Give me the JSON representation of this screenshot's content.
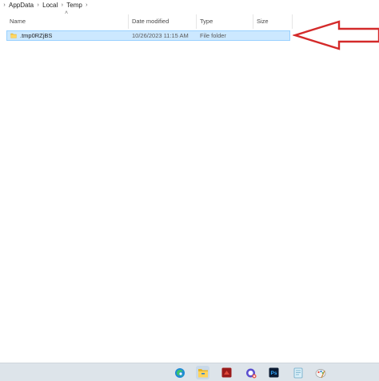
{
  "breadcrumb": {
    "items": [
      "AppData",
      "Local",
      "Temp"
    ]
  },
  "columns": {
    "name": "Name",
    "date_modified": "Date modified",
    "type": "Type",
    "size": "Size"
  },
  "rows": [
    {
      "name": ".tmp0RZjBS",
      "date_modified": "10/26/2023 11:15 AM",
      "type": "File folder",
      "size": "",
      "icon": "folder-icon",
      "selected": true
    }
  ],
  "annotation": {
    "type": "arrow",
    "color": "#d42a2a",
    "points_to": "row-0"
  },
  "taskbar": {
    "apps": [
      {
        "name": "edge-icon"
      },
      {
        "name": "file-explorer-icon",
        "active": true
      },
      {
        "name": "red-app-icon"
      },
      {
        "name": "snipping-tool-icon"
      },
      {
        "name": "photoshop-icon",
        "label": "Ps"
      },
      {
        "name": "notepad-icon"
      },
      {
        "name": "paint-icon"
      }
    ]
  },
  "colors": {
    "selection_bg": "#cce8ff",
    "selection_border": "#99d1ff",
    "taskbar_bg": "#dde4ea",
    "arrow": "#d42a2a"
  }
}
